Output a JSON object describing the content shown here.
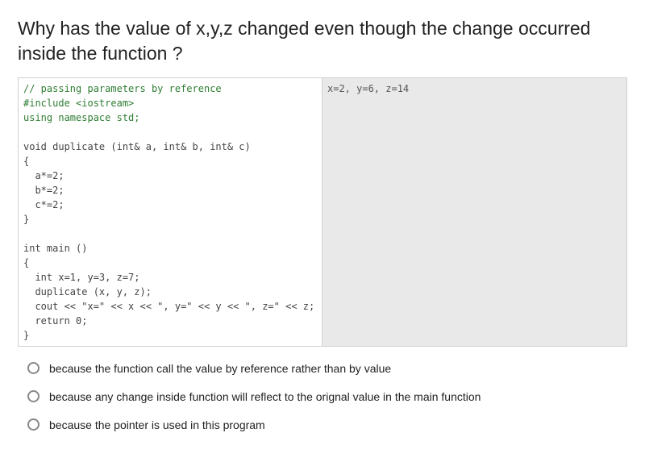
{
  "question": "Why has the value of x,y,z changed even though the change occurred inside the function ?",
  "code": {
    "lines": [
      {
        "cls": "cmt",
        "t": "// passing parameters by reference"
      },
      {
        "cls": "pre",
        "t": "#include <iostream>"
      },
      {
        "cls": "kw",
        "t": "using namespace std;"
      },
      {
        "cls": "",
        "t": ""
      },
      {
        "cls": "",
        "t": "void duplicate (int& a, int& b, int& c)"
      },
      {
        "cls": "",
        "t": "{"
      },
      {
        "cls": "",
        "t": "  a*=2;"
      },
      {
        "cls": "",
        "t": "  b*=2;"
      },
      {
        "cls": "",
        "t": "  c*=2;"
      },
      {
        "cls": "",
        "t": "}"
      },
      {
        "cls": "",
        "t": ""
      },
      {
        "cls": "",
        "t": "int main ()"
      },
      {
        "cls": "",
        "t": "{"
      },
      {
        "cls": "",
        "t": "  int x=1, y=3, z=7;"
      },
      {
        "cls": "",
        "t": "  duplicate (x, y, z);"
      },
      {
        "cls": "",
        "t": "  cout << \"x=\" << x << \", y=\" << y << \", z=\" << z;"
      },
      {
        "cls": "",
        "t": "  return 0;"
      },
      {
        "cls": "",
        "t": "}"
      }
    ],
    "output": "x=2, y=6, z=14"
  },
  "answers": [
    "because the function call the value by reference rather than by value",
    "because any change inside function will reflect to the orignal value in the main function",
    "because the pointer is used in this program"
  ]
}
